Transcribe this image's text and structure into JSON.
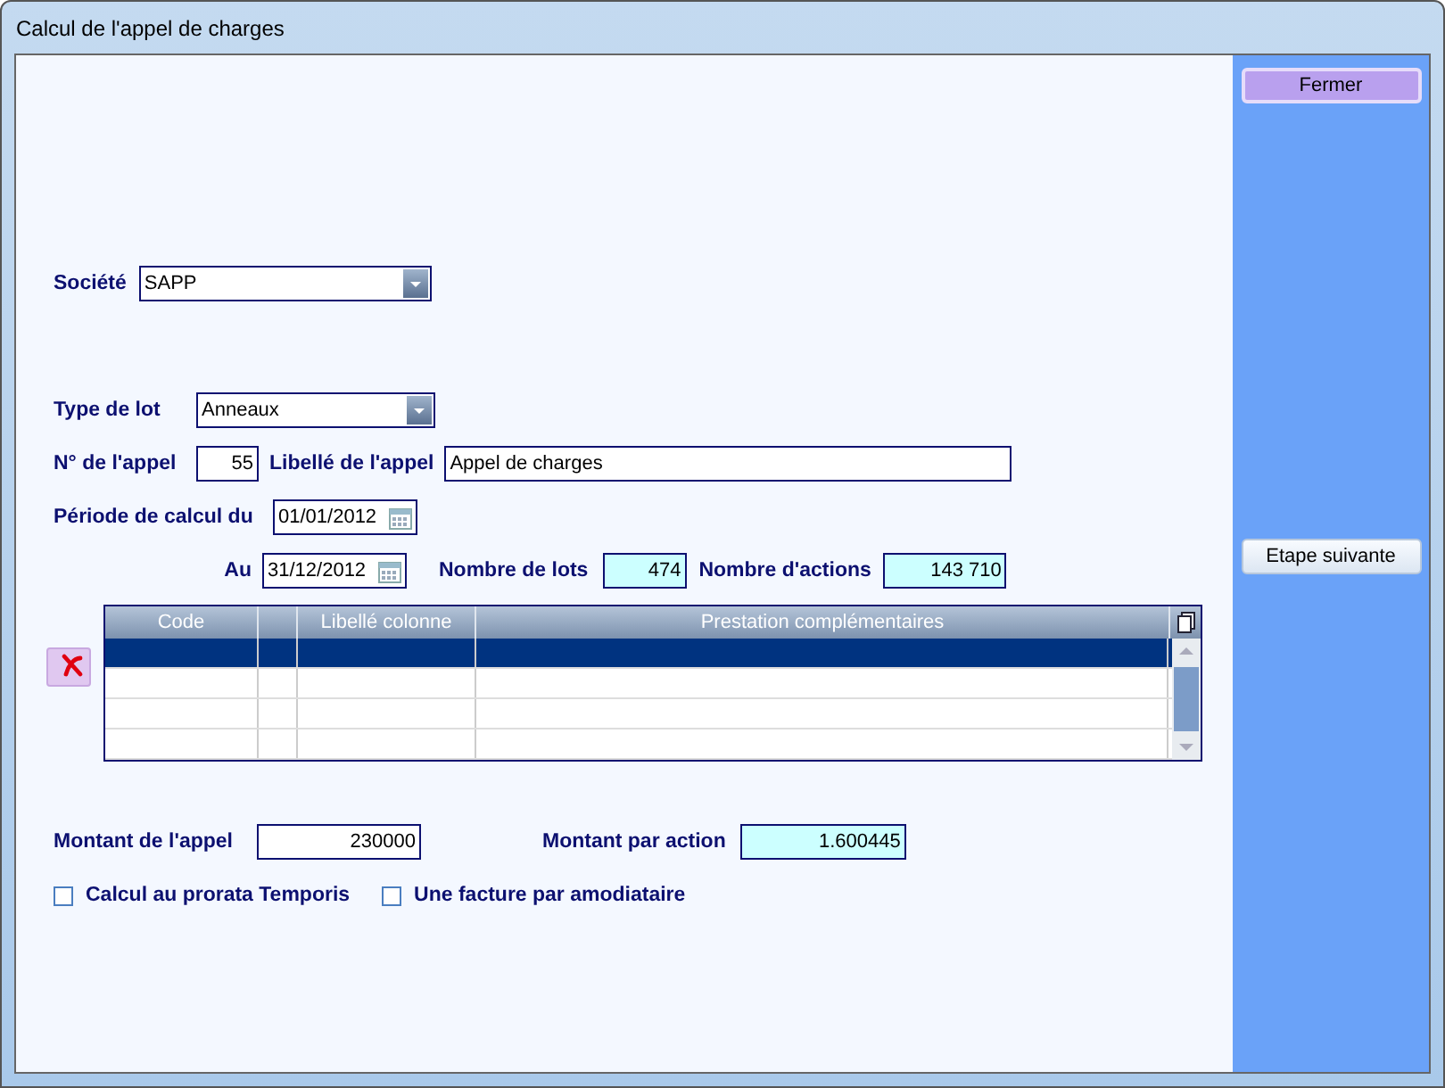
{
  "window": {
    "title": "Calcul de l'appel de charges"
  },
  "societe": {
    "label": "Société",
    "value": "SAPP"
  },
  "type_lot": {
    "label": "Type de lot",
    "value": "Anneaux"
  },
  "numero": {
    "label": "N° de l'appel",
    "value": "55"
  },
  "libelle": {
    "label": "Libellé de l'appel",
    "value": "Appel de charges"
  },
  "periode_du": {
    "label": "Période de calcul du",
    "value": "01/01/2012"
  },
  "periode_au": {
    "label": "Au",
    "value": "31/12/2012"
  },
  "nombre_lots": {
    "label": "Nombre de lots",
    "value": "474"
  },
  "nombre_actions": {
    "label": "Nombre d'actions",
    "value": "143 710"
  },
  "table": {
    "columns": [
      "Code",
      "",
      "Libellé colonne",
      "Prestation complémentaires"
    ],
    "rows": [
      {
        "selected": true
      },
      {
        "selected": false
      },
      {
        "selected": false
      },
      {
        "selected": false
      }
    ]
  },
  "montant_appel": {
    "label": "Montant de l'appel",
    "value": "230000"
  },
  "montant_action": {
    "label": "Montant par action",
    "value": "1.600445"
  },
  "checkboxes": [
    {
      "label": "Calcul au prorata Temporis",
      "checked": false
    },
    {
      "label": "Une facture par amodiataire",
      "checked": false
    }
  ],
  "buttons": [
    {
      "label": "Fermer",
      "focused": true
    },
    {
      "label": "Etape suivante",
      "focused": false
    }
  ]
}
